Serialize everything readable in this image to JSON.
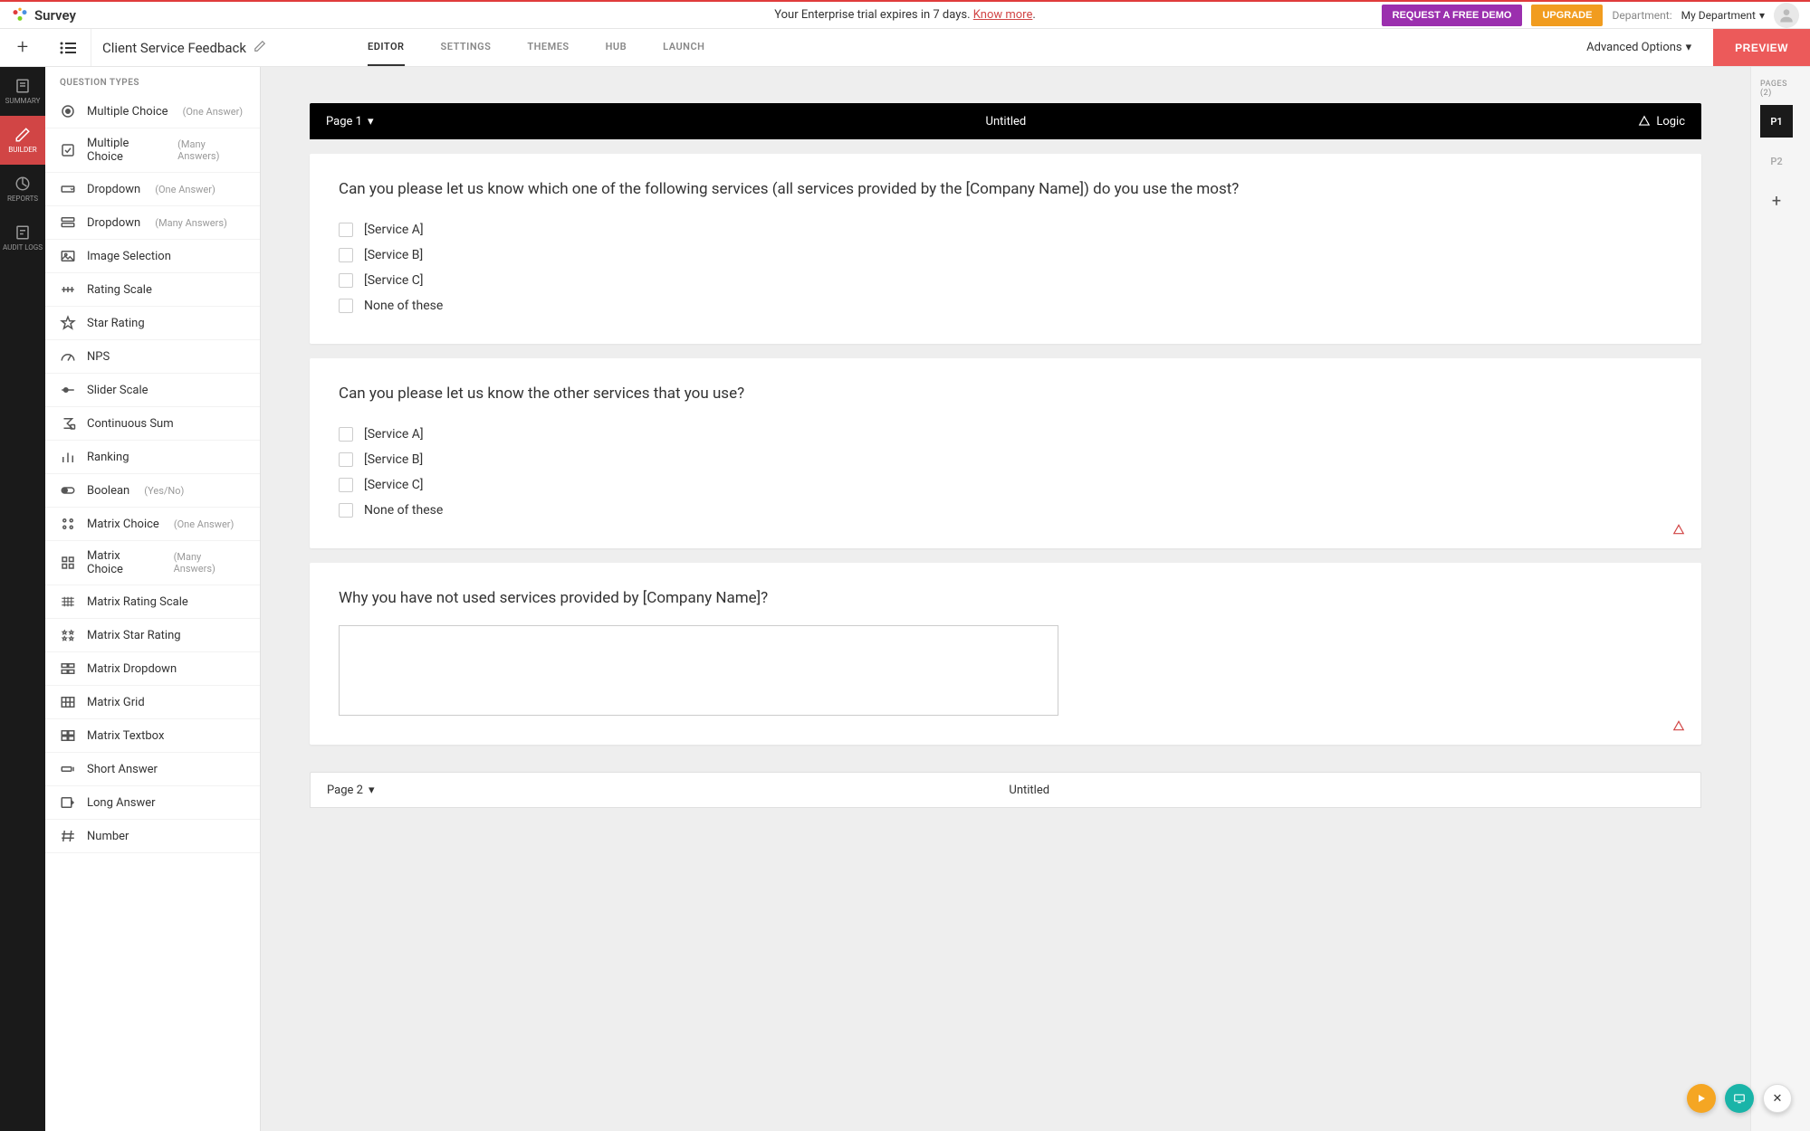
{
  "topbar": {
    "logo_text": "Survey",
    "trial_prefix": "Your Enterprise trial expires in 7 days. ",
    "trial_link": "Know more",
    "trial_suffix": ".",
    "demo_btn": "REQUEST A FREE DEMO",
    "upgrade_btn": "UPGRADE",
    "dept_label": "Department:",
    "dept_value": "My Department"
  },
  "subbar": {
    "survey_name": "Client Service Feedback",
    "tabs": [
      "EDITOR",
      "SETTINGS",
      "THEMES",
      "HUB",
      "LAUNCH"
    ],
    "active_tab": 0,
    "advanced": "Advanced Options",
    "preview": "PREVIEW"
  },
  "rail": [
    {
      "label": "SUMMARY"
    },
    {
      "label": "BUILDER"
    },
    {
      "label": "REPORTS"
    },
    {
      "label": "AUDIT LOGS"
    }
  ],
  "qtypes_header": "QUESTION TYPES",
  "qtypes": [
    {
      "icon": "radio",
      "label": "Multiple Choice",
      "sub": "(One Answer)"
    },
    {
      "icon": "check",
      "label": "Multiple Choice",
      "sub": "(Many Answers)"
    },
    {
      "icon": "dropdown1",
      "label": "Dropdown",
      "sub": "(One Answer)"
    },
    {
      "icon": "dropdown2",
      "label": "Dropdown",
      "sub": "(Many Answers)"
    },
    {
      "icon": "image",
      "label": "Image Selection",
      "sub": ""
    },
    {
      "icon": "rating",
      "label": "Rating Scale",
      "sub": ""
    },
    {
      "icon": "star",
      "label": "Star Rating",
      "sub": ""
    },
    {
      "icon": "nps",
      "label": "NPS",
      "sub": ""
    },
    {
      "icon": "slider",
      "label": "Slider Scale",
      "sub": ""
    },
    {
      "icon": "sum",
      "label": "Continuous Sum",
      "sub": ""
    },
    {
      "icon": "ranking",
      "label": "Ranking",
      "sub": ""
    },
    {
      "icon": "boolean",
      "label": "Boolean",
      "sub": "(Yes/No)"
    },
    {
      "icon": "matrix1",
      "label": "Matrix Choice",
      "sub": "(One Answer)"
    },
    {
      "icon": "matrix2",
      "label": "Matrix Choice",
      "sub": "(Many Answers)"
    },
    {
      "icon": "matrixrating",
      "label": "Matrix Rating Scale",
      "sub": ""
    },
    {
      "icon": "matrixstar",
      "label": "Matrix Star Rating",
      "sub": ""
    },
    {
      "icon": "matrixdrop",
      "label": "Matrix Dropdown",
      "sub": ""
    },
    {
      "icon": "matrixgrid",
      "label": "Matrix Grid",
      "sub": ""
    },
    {
      "icon": "matrixtext",
      "label": "Matrix Textbox",
      "sub": ""
    },
    {
      "icon": "short",
      "label": "Short Answer",
      "sub": ""
    },
    {
      "icon": "long",
      "label": "Long Answer",
      "sub": ""
    },
    {
      "icon": "number",
      "label": "Number",
      "sub": ""
    }
  ],
  "canvas": {
    "page1_label": "Page 1",
    "page1_title": "Untitled",
    "logic_label": "Logic",
    "page2_label": "Page 2",
    "page2_title": "Untitled",
    "questions": [
      {
        "text": "Can you please let us know which one of the following services (all services provided by the [Company Name]) do you use the most?",
        "options": [
          "[Service A]",
          "[Service B]",
          "[Service C]",
          "None of these"
        ],
        "has_logic": false
      },
      {
        "text": "Can you please let us know the other services that you use?",
        "options": [
          "[Service A]",
          "[Service B]",
          "[Service C]",
          "None of these"
        ],
        "has_logic": true
      },
      {
        "text": "Why you have not used services provided by [Company Name]?",
        "options": [],
        "has_textarea": true,
        "has_logic": true
      }
    ]
  },
  "rightcol": {
    "title": "PAGES (2)",
    "pages": [
      "P1",
      "P2"
    ]
  }
}
